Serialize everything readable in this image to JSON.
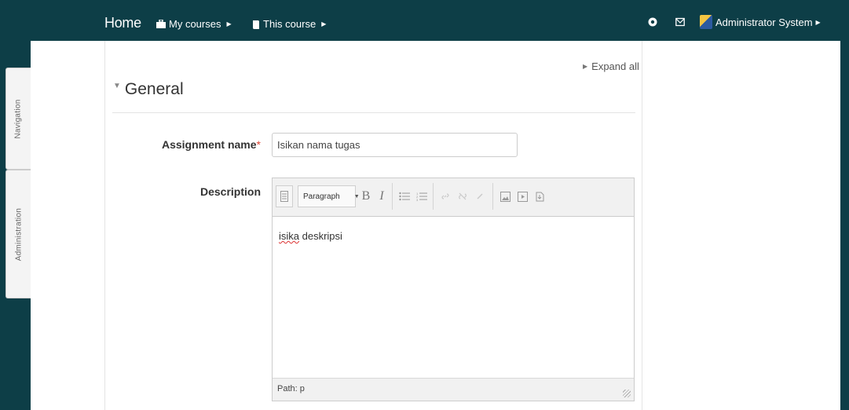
{
  "navbar": {
    "home": "Home",
    "my_courses": "My courses",
    "this_course": "This course",
    "user_name": "Administrator System"
  },
  "side_blocks": {
    "navigation": "Navigation",
    "administration": "Administration"
  },
  "form": {
    "expand_all": "Expand all",
    "section_title": "General",
    "assignment_name_label": "Assignment name",
    "required_mark": "*",
    "assignment_name_value": "Isikan nama tugas",
    "description_label": "Description"
  },
  "editor": {
    "format_select": "Paragraph",
    "bold": "B",
    "italic": "I",
    "content_word1": "isika",
    "content_word2": " deskripsi",
    "path": "Path: p"
  },
  "colors": {
    "navbar_bg": "#0d3e47",
    "required": "#dd4433"
  }
}
